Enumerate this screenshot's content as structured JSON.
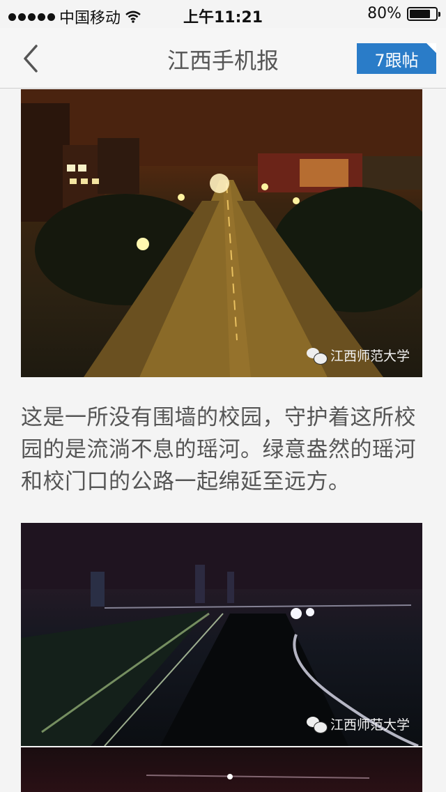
{
  "status_bar": {
    "carrier": "中国移动",
    "time": "上午11:21",
    "battery_text": "80%",
    "battery_level": 0.8
  },
  "nav": {
    "title": "江西手机报",
    "reply_label": "7跟帖",
    "accent_color": "#2a7cc8"
  },
  "article": {
    "photos": [
      {
        "watermark": "江西师范大学"
      },
      {
        "watermark": "江西师范大学"
      }
    ],
    "paragraph": "这是一所没有围墙的校园，守护着这所校园的是流淌不息的瑶河。绿意盎然的瑶河和校门口的公路一起绵延至远方。"
  }
}
